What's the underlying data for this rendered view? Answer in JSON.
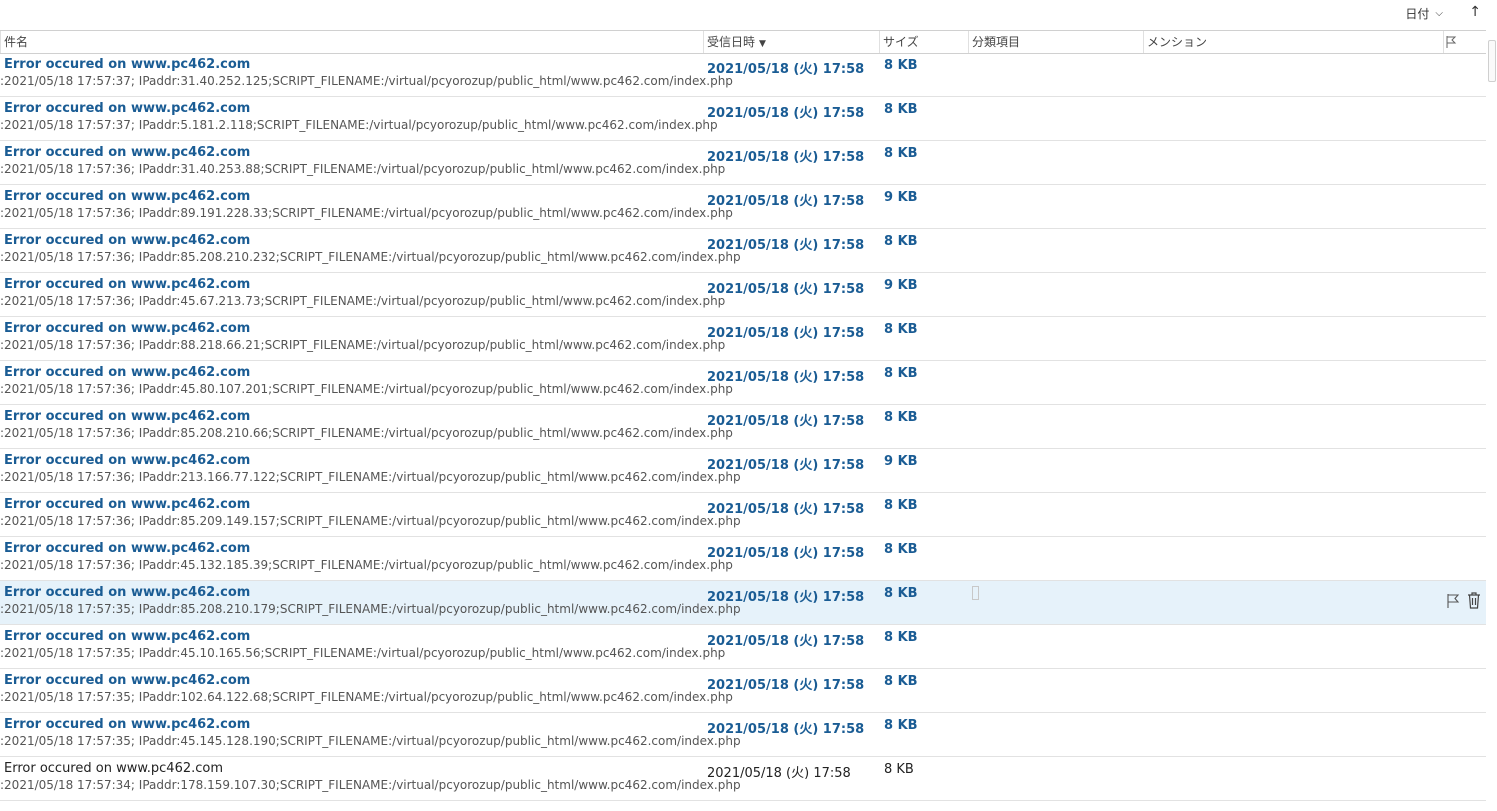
{
  "toolbar": {
    "sort_label": "日付",
    "sort_chevron": "⌵",
    "sort_direction": "↑"
  },
  "columns": {
    "subject": "件名",
    "received": "受信日時",
    "received_sort": "▼",
    "size": "サイズ",
    "category": "分類項目",
    "mention": "メンション"
  },
  "colors": {
    "unread_text": "#1a5c94",
    "selected_row": "#e6f2fa"
  },
  "messages": [
    {
      "subject": "Error occured on www.pc462.com",
      "preview": ":2021/05/18 17:57:37; IPaddr:31.40.252.125;SCRIPT_FILENAME:/virtual/pcyorozup/public_html/www.pc462.com/index.php",
      "received": "2021/05/18 (火) 17:58",
      "size": "8 KB",
      "unread": true
    },
    {
      "subject": "Error occured on www.pc462.com",
      "preview": ":2021/05/18 17:57:37; IPaddr:5.181.2.118;SCRIPT_FILENAME:/virtual/pcyorozup/public_html/www.pc462.com/index.php",
      "received": "2021/05/18 (火) 17:58",
      "size": "8 KB",
      "unread": true
    },
    {
      "subject": "Error occured on www.pc462.com",
      "preview": ":2021/05/18 17:57:36; IPaddr:31.40.253.88;SCRIPT_FILENAME:/virtual/pcyorozup/public_html/www.pc462.com/index.php",
      "received": "2021/05/18 (火) 17:58",
      "size": "8 KB",
      "unread": true
    },
    {
      "subject": "Error occured on www.pc462.com",
      "preview": ":2021/05/18 17:57:36; IPaddr:89.191.228.33;SCRIPT_FILENAME:/virtual/pcyorozup/public_html/www.pc462.com/index.php",
      "received": "2021/05/18 (火) 17:58",
      "size": "9 KB",
      "unread": true
    },
    {
      "subject": "Error occured on www.pc462.com",
      "preview": ":2021/05/18 17:57:36; IPaddr:85.208.210.232;SCRIPT_FILENAME:/virtual/pcyorozup/public_html/www.pc462.com/index.php",
      "received": "2021/05/18 (火) 17:58",
      "size": "8 KB",
      "unread": true
    },
    {
      "subject": "Error occured on www.pc462.com",
      "preview": ":2021/05/18 17:57:36; IPaddr:45.67.213.73;SCRIPT_FILENAME:/virtual/pcyorozup/public_html/www.pc462.com/index.php",
      "received": "2021/05/18 (火) 17:58",
      "size": "9 KB",
      "unread": true
    },
    {
      "subject": "Error occured on www.pc462.com",
      "preview": ":2021/05/18 17:57:36; IPaddr:88.218.66.21;SCRIPT_FILENAME:/virtual/pcyorozup/public_html/www.pc462.com/index.php",
      "received": "2021/05/18 (火) 17:58",
      "size": "8 KB",
      "unread": true
    },
    {
      "subject": "Error occured on www.pc462.com",
      "preview": ":2021/05/18 17:57:36; IPaddr:45.80.107.201;SCRIPT_FILENAME:/virtual/pcyorozup/public_html/www.pc462.com/index.php",
      "received": "2021/05/18 (火) 17:58",
      "size": "8 KB",
      "unread": true
    },
    {
      "subject": "Error occured on www.pc462.com",
      "preview": ":2021/05/18 17:57:36; IPaddr:85.208.210.66;SCRIPT_FILENAME:/virtual/pcyorozup/public_html/www.pc462.com/index.php",
      "received": "2021/05/18 (火) 17:58",
      "size": "8 KB",
      "unread": true
    },
    {
      "subject": "Error occured on www.pc462.com",
      "preview": ":2021/05/18 17:57:36; IPaddr:213.166.77.122;SCRIPT_FILENAME:/virtual/pcyorozup/public_html/www.pc462.com/index.php",
      "received": "2021/05/18 (火) 17:58",
      "size": "9 KB",
      "unread": true
    },
    {
      "subject": "Error occured on www.pc462.com",
      "preview": ":2021/05/18 17:57:36; IPaddr:85.209.149.157;SCRIPT_FILENAME:/virtual/pcyorozup/public_html/www.pc462.com/index.php",
      "received": "2021/05/18 (火) 17:58",
      "size": "8 KB",
      "unread": true
    },
    {
      "subject": "Error occured on www.pc462.com",
      "preview": ":2021/05/18 17:57:36; IPaddr:45.132.185.39;SCRIPT_FILENAME:/virtual/pcyorozup/public_html/www.pc462.com/index.php",
      "received": "2021/05/18 (火) 17:58",
      "size": "8 KB",
      "unread": true
    },
    {
      "subject": "Error occured on www.pc462.com",
      "preview": ":2021/05/18 17:57:35; IPaddr:85.208.210.179;SCRIPT_FILENAME:/virtual/pcyorozup/public_html/www.pc462.com/index.php",
      "received": "2021/05/18 (火) 17:58",
      "size": "8 KB",
      "unread": true,
      "selected": true
    },
    {
      "subject": "Error occured on www.pc462.com",
      "preview": ":2021/05/18 17:57:35; IPaddr:45.10.165.56;SCRIPT_FILENAME:/virtual/pcyorozup/public_html/www.pc462.com/index.php",
      "received": "2021/05/18 (火) 17:58",
      "size": "8 KB",
      "unread": true
    },
    {
      "subject": "Error occured on www.pc462.com",
      "preview": ":2021/05/18 17:57:35; IPaddr:102.64.122.68;SCRIPT_FILENAME:/virtual/pcyorozup/public_html/www.pc462.com/index.php",
      "received": "2021/05/18 (火) 17:58",
      "size": "8 KB",
      "unread": true
    },
    {
      "subject": "Error occured on www.pc462.com",
      "preview": ":2021/05/18 17:57:35; IPaddr:45.145.128.190;SCRIPT_FILENAME:/virtual/pcyorozup/public_html/www.pc462.com/index.php",
      "received": "2021/05/18 (火) 17:58",
      "size": "8 KB",
      "unread": true
    },
    {
      "subject": "Error occured on www.pc462.com",
      "preview": ":2021/05/18 17:57:34; IPaddr:178.159.107.30;SCRIPT_FILENAME:/virtual/pcyorozup/public_html/www.pc462.com/index.php",
      "received": "2021/05/18 (火) 17:58",
      "size": "8 KB",
      "unread": false
    }
  ]
}
